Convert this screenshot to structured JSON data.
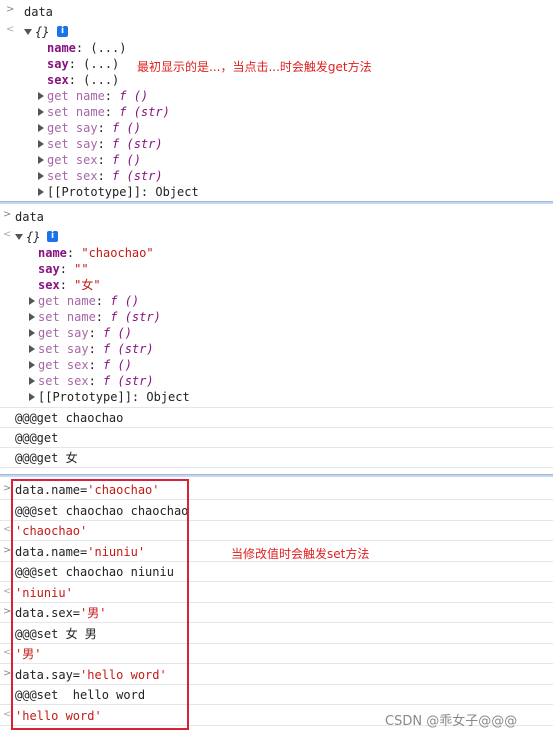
{
  "panel1": {
    "cmd": "data",
    "obj": "{}",
    "info": "i",
    "props": [
      {
        "k": "name",
        "v": "(...)"
      },
      {
        "k": "say",
        "v": "(...)"
      },
      {
        "k": "sex",
        "v": "(...)"
      }
    ],
    "accessors": [
      {
        "k": "get name",
        "v": "f ()"
      },
      {
        "k": "set name",
        "v": "f (str)"
      },
      {
        "k": "get say",
        "v": "f ()"
      },
      {
        "k": "set say",
        "v": "f (str)"
      },
      {
        "k": "get sex",
        "v": "f ()"
      },
      {
        "k": "set sex",
        "v": "f (str)"
      }
    ],
    "proto_key": "[[Prototype]]",
    "proto_val": "Object",
    "note": "最初显示的是...，当点击...时会触发get方法"
  },
  "panel2": {
    "cmd": "data",
    "obj": "{}",
    "info": "i",
    "props": [
      {
        "k": "name",
        "v": "\"chaochao\""
      },
      {
        "k": "say",
        "v": "\"\""
      },
      {
        "k": "sex",
        "v": "\"女\""
      }
    ],
    "accessors": [
      {
        "k": "get name",
        "v": "f ()"
      },
      {
        "k": "set name",
        "v": "f (str)"
      },
      {
        "k": "get say",
        "v": "f ()"
      },
      {
        "k": "set say",
        "v": "f (str)"
      },
      {
        "k": "get sex",
        "v": "f ()"
      },
      {
        "k": "set sex",
        "v": "f (str)"
      }
    ],
    "proto_key": "[[Prototype]]",
    "proto_val": "Object",
    "logs": [
      "@@@get chaochao",
      "@@@get",
      "@@@get 女"
    ]
  },
  "panel3": {
    "rows": [
      {
        "type": "in",
        "a": "data.name=",
        "b": "'chaochao'"
      },
      {
        "type": "log",
        "a": "@@@set chaochao chaochao"
      },
      {
        "type": "out",
        "b": "'chaochao'"
      },
      {
        "type": "in",
        "a": "data.name=",
        "b": "'niuniu'"
      },
      {
        "type": "log",
        "a": "@@@set chaochao niuniu"
      },
      {
        "type": "out",
        "b": "'niuniu'"
      },
      {
        "type": "in",
        "a": "data.sex=",
        "b": "'男'"
      },
      {
        "type": "log",
        "a": "@@@set 女 男"
      },
      {
        "type": "out",
        "b": "'男'"
      },
      {
        "type": "in",
        "a": "data.say=",
        "b": "'hello word'"
      },
      {
        "type": "log",
        "a": "@@@set  hello word"
      },
      {
        "type": "out",
        "b": "'hello word'"
      }
    ],
    "note": "当修改值时会触发set方法"
  },
  "watermark": "CSDN @乖女子@@@",
  "colors": {
    "accent_red": "#d9223a",
    "string": "#c41a16",
    "key": "#881280"
  }
}
